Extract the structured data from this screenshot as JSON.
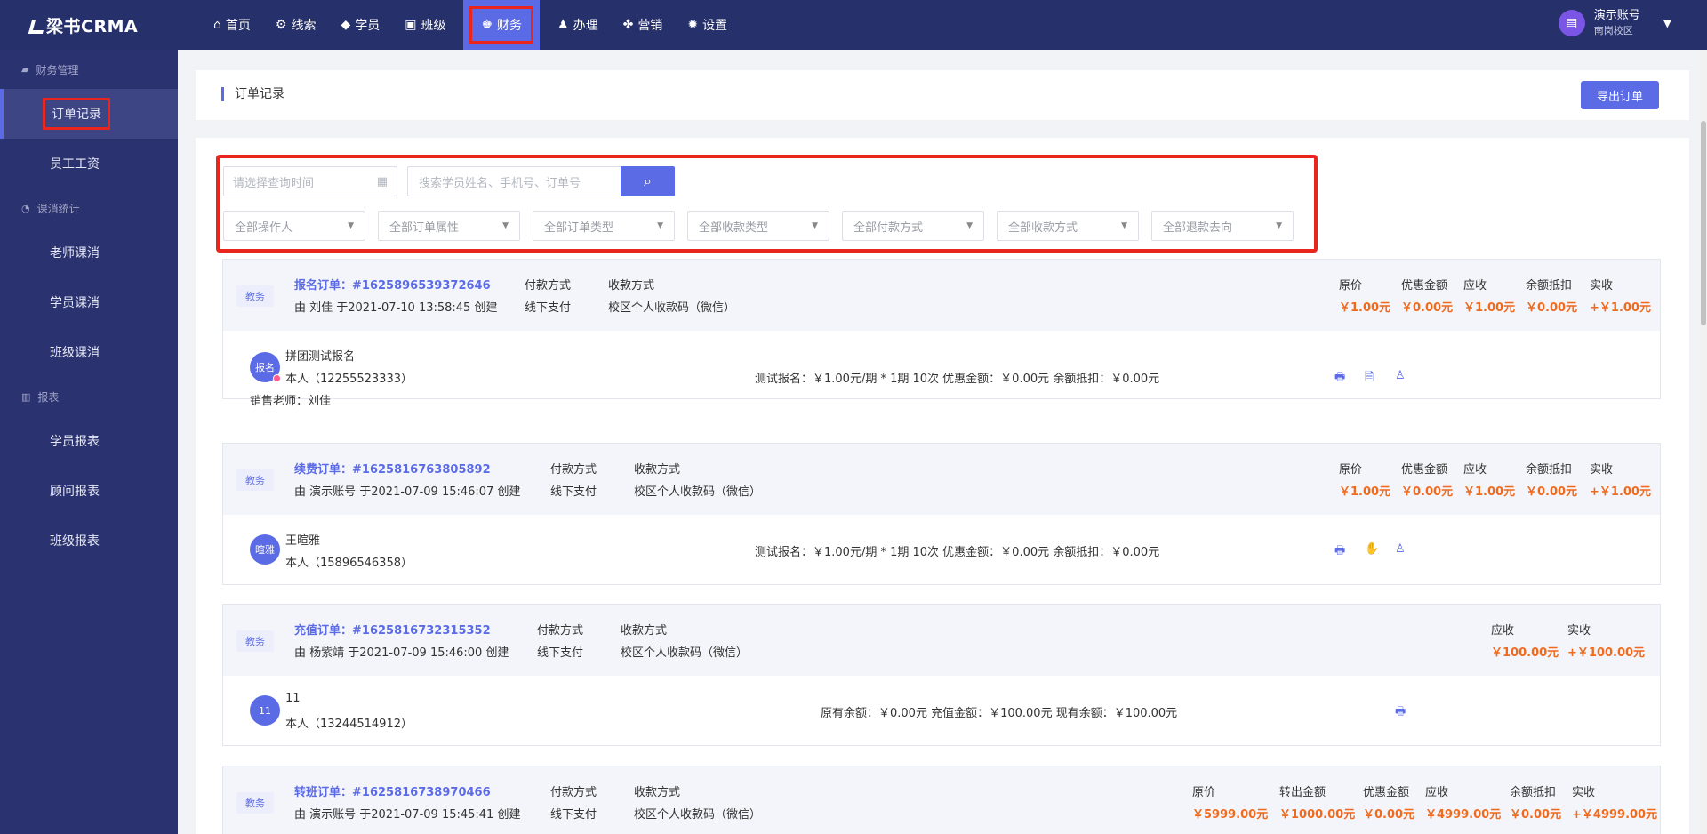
{
  "app": {
    "logo": "梁书CRMA"
  },
  "nav": [
    {
      "label": "首页",
      "icon": "⌂"
    },
    {
      "label": "线索",
      "icon": "⚙"
    },
    {
      "label": "学员",
      "icon": "◆"
    },
    {
      "label": "班级",
      "icon": "▣"
    },
    {
      "label": "财务",
      "icon": "♚"
    },
    {
      "label": "办理",
      "icon": "♟"
    },
    {
      "label": "营销",
      "icon": "✤"
    },
    {
      "label": "设置",
      "icon": "✹"
    }
  ],
  "user": {
    "name": "演示账号",
    "school": "南岗校区"
  },
  "sidebar": {
    "groups": [
      {
        "label": "财务管理",
        "items": [
          "订单记录",
          "员工工资"
        ]
      },
      {
        "label": "课消统计",
        "items": [
          "老师课消",
          "学员课消",
          "班级课消"
        ]
      },
      {
        "label": "报表",
        "items": [
          "学员报表",
          "顾问报表",
          "班级报表"
        ]
      }
    ]
  },
  "page": {
    "title": "订单记录",
    "export_label": "导出订单"
  },
  "filters": {
    "date_placeholder": "请选择查询时间",
    "search_placeholder": "搜索学员姓名、手机号、订单号",
    "selects": [
      "全部操作人",
      "全部订单属性",
      "全部订单类型",
      "全部收款类型",
      "全部付款方式",
      "全部收款方式",
      "全部退款去向"
    ]
  },
  "labels": {
    "pay_method": "付款方式",
    "receive_method": "收款方式",
    "original": "原价",
    "discount": "优惠金额",
    "receivable": "应收",
    "balance_deduct": "余额抵扣",
    "actual": "实收",
    "transfer_out": "转出金额",
    "seller": "销售老师："
  },
  "orders": [
    {
      "tag": "教务",
      "order_no": "报名订单：#1625896539372646",
      "creator": "由 刘佳 于2021-07-10 13:58:45 创建",
      "pay_method": "线下支付",
      "receive_method": "校区个人收款码（微信）",
      "amounts": {
        "original": "￥1.00元",
        "discount": "￥0.00元",
        "receivable": "￥1.00元",
        "balance_deduct": "￥0.00元",
        "actual": "+￥1.00元"
      },
      "student": {
        "avatar": "报名",
        "title": "拼团测试报名",
        "contact": "本人（12255523333）",
        "seller": "刘佳"
      },
      "detail": "测试报名：￥1.00元/期 * 1期 10次   优惠金额：￥0.00元   余额抵扣：￥0.00元"
    },
    {
      "tag": "教务",
      "order_no": "续费订单：#1625816763805892",
      "creator": "由 演示账号 于2021-07-09 15:46:07 创建",
      "pay_method": "线下支付",
      "receive_method": "校区个人收款码（微信）",
      "amounts": {
        "original": "￥1.00元",
        "discount": "￥0.00元",
        "receivable": "￥1.00元",
        "balance_deduct": "￥0.00元",
        "actual": "+￥1.00元"
      },
      "student": {
        "avatar": "暄雅",
        "title": "王暄雅",
        "contact": "本人（15896546358）"
      },
      "detail": "测试报名：￥1.00元/期 * 1期 10次   优惠金额：￥0.00元   余额抵扣：￥0.00元"
    },
    {
      "tag": "教务",
      "order_no": "充值订单：#1625816732315352",
      "creator": "由 杨紫靖 于2021-07-09 15:46:00 创建",
      "pay_method": "线下支付",
      "receive_method": "校区个人收款码（微信）",
      "amounts": {
        "receivable": "￥100.00元",
        "actual": "+￥100.00元"
      },
      "student": {
        "avatar": "11",
        "title": "11",
        "contact": "本人（13244514912）"
      },
      "detail": "原有余额：￥0.00元 充值金额：￥100.00元 现有余额：￥100.00元"
    },
    {
      "tag": "教务",
      "order_no": "转班订单：#1625816738970466",
      "creator": "由 演示账号 于2021-07-09 15:45:41 创建",
      "pay_method": "线下支付",
      "receive_method": "校区个人收款码（微信）",
      "amounts": {
        "original": "￥5999.00元",
        "transfer_out": "￥1000.00元",
        "discount": "￥0.00元",
        "receivable": "￥4999.00元",
        "balance_deduct": "￥0.00元",
        "actual": "+￥4999.00元"
      }
    }
  ],
  "icons": {
    "print": "🖶",
    "receipt": "🗎",
    "person": "♙",
    "search": "⌕",
    "calendar": "▦",
    "caret": "▼"
  },
  "colors": {
    "topbar": "#26306a",
    "sidebar": "#2b3270",
    "accent": "#5b6be6",
    "amount": "#f06a1d",
    "highlight": "#e8261d"
  }
}
